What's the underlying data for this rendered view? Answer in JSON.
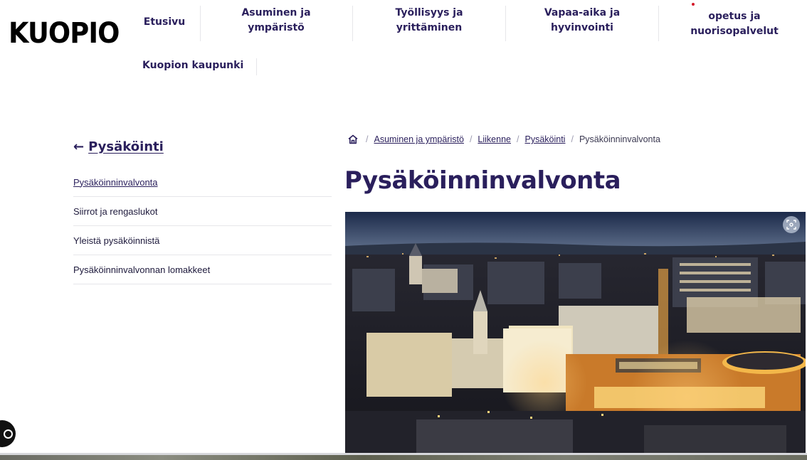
{
  "header": {
    "logo": "KUOPIO",
    "nav": [
      {
        "label": "Etusivu"
      },
      {
        "label": "Asuminen ja\nympäristö"
      },
      {
        "label": "Työllisyys ja\nyrittäminen"
      },
      {
        "label": "Vapaa-aika ja\nhyvinvointi"
      },
      {
        "label": "opetus ja\nnuorisopalvelut"
      }
    ],
    "nav_second": "Kuopion kaupunki"
  },
  "sidebar": {
    "back_label": "Pysäköinti",
    "back_arrow": "←",
    "items": [
      {
        "label": "Pysäköinninvalvonta",
        "active": true
      },
      {
        "label": "Siirrot ja rengaslukot"
      },
      {
        "label": "Yleistä pysäköinnistä"
      },
      {
        "label": "Pysäköinninvalvonnan lomakkeet"
      }
    ]
  },
  "breadcrumb": {
    "home_icon": "home-icon",
    "items": [
      "Asuminen ja ympäristö",
      "Liikenne",
      "Pysäköinti"
    ],
    "current": "Pysäköinninvalvonta",
    "separator": "/"
  },
  "page": {
    "title": "Pysäköinninvalvonta"
  },
  "hero": {
    "zoom_icon": "zoom-icon"
  },
  "colors": {
    "brand": "#2a1f5c",
    "accent_red": "#d41a2a"
  }
}
